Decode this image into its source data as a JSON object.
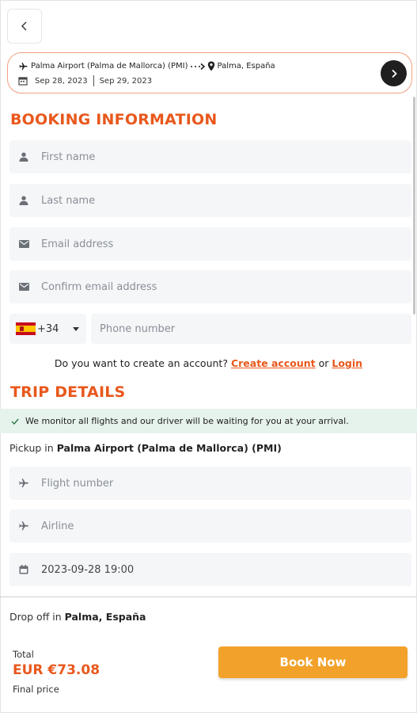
{
  "route": {
    "from": "Palma Airport (Palma de Mallorca) (PMI)",
    "to": "Palma, España",
    "date_out": "Sep 28, 2023",
    "date_return": "Sep 29, 2023"
  },
  "booking": {
    "title": "BOOKING INFORMATION",
    "first_name_placeholder": "First name",
    "last_name_placeholder": "Last name",
    "email_placeholder": "Email address",
    "confirm_email_placeholder": "Confirm email address",
    "country_code": "+34",
    "phone_placeholder": "Phone number",
    "account_question": "Do you want to create an account?",
    "create_account": "Create account",
    "or": "or",
    "login": "Login"
  },
  "trip": {
    "title": "TRIP DETAILS",
    "notice": "We monitor all flights and our driver will be waiting for you at your arrival.",
    "pickup_prefix": "Pickup in",
    "pickup_location": "Palma Airport (Palma de Mallorca) (PMI)",
    "flight_placeholder": "Flight number",
    "airline_placeholder": "Airline",
    "datetime_value": "2023-09-28 19:00",
    "dropoff_prefix": "Drop off in",
    "dropoff_location": "Palma, España"
  },
  "footer": {
    "total_label": "Total",
    "total_price": "EUR €73.08",
    "final_label": "Final price",
    "book_button": "Book Now"
  },
  "colors": {
    "accent": "#e8581c",
    "book_button": "#f2a22a",
    "notice_bg": "#e6f2ec"
  }
}
